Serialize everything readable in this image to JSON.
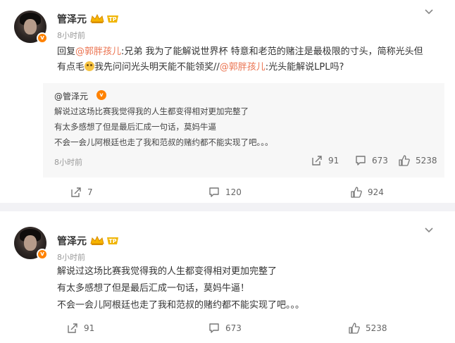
{
  "post1": {
    "author": "管泽元",
    "time": "8小时前",
    "reply_prefix": "回复",
    "mention1": "@郭胖孩儿",
    "text_a": ":兄弟 我为了能解说世界杯 特意和老范的赌注是最极限的寸头，简称光头但有点毛",
    "text_b": "我先问问光头明天能不能领奖//",
    "mention2": "@郭胖孩儿",
    "text_c": ":光头能解说LPL吗?",
    "quote": {
      "author": "@管泽元",
      "lines": [
        "解说过这场比赛我觉得我的人生都变得相对更加完整了",
        "有太多感想了但是最后汇成一句话，莫妈牛逼",
        "不会一会儿阿根廷也走了我和范叔的赌约都不能实现了吧。。。"
      ],
      "time": "8小时前",
      "reposts": "91",
      "comments": "673",
      "likes": "5238"
    },
    "reposts": "7",
    "comments": "120",
    "likes": "924"
  },
  "post2": {
    "author": "管泽元",
    "time": "8小时前",
    "lines": [
      "解说过这场比赛我觉得我的人生都变得相对更加完整了",
      "有太多感想了但是最后汇成一句话，莫妈牛逼！",
      "不会一会儿阿根廷也走了我和范叔的赌约都不能实现了吧。。。"
    ],
    "reposts": "91",
    "comments": "673",
    "likes": "5238"
  },
  "colors": {
    "mention": "#eb7350",
    "vip_badge": "#ff8200"
  },
  "icons": [
    "crown-icon",
    "id-badge-icon",
    "chevron-down-icon",
    "repost-icon",
    "comment-icon",
    "like-icon"
  ]
}
